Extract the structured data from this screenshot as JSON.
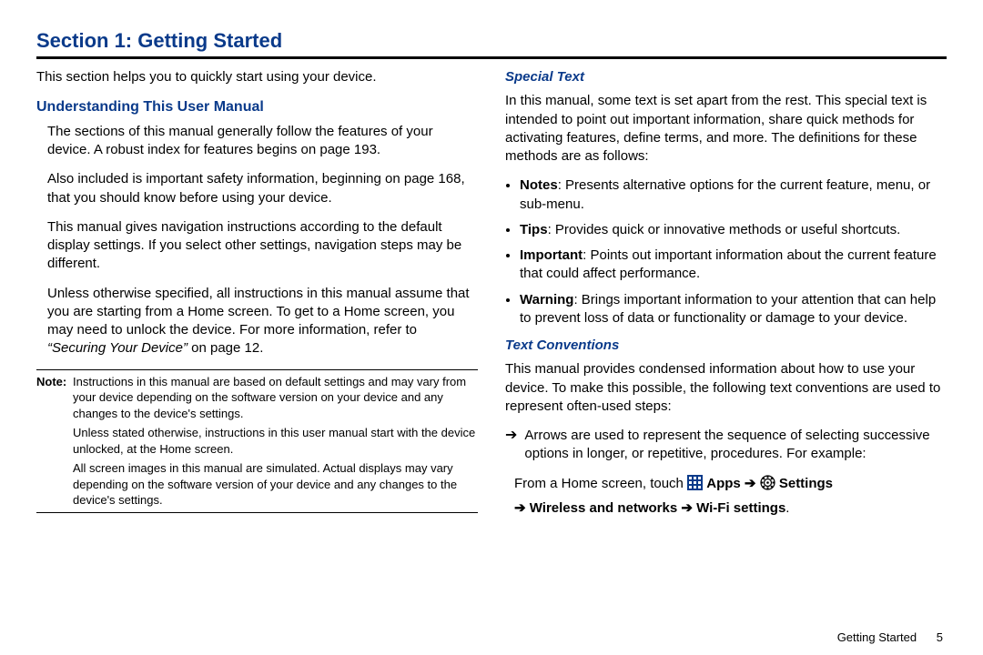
{
  "section_title": "Section 1: Getting Started",
  "left": {
    "intro": "This section helps you to quickly start using your device.",
    "h_understanding": "Understanding This User Manual",
    "p1": "The sections of this manual generally follow the features of your device. A robust index for features begins on page 193.",
    "p2": "Also included is important safety information, beginning on page 168, that you should know before using your device.",
    "p3": "This manual gives navigation instructions according to the default display settings. If you select other settings, navigation steps may be different.",
    "p4a": "Unless otherwise specified, all instructions in this manual assume that you are starting from a Home screen. To get to a Home screen, you may need to unlock the device. For more information, refer to ",
    "p4_ref": "“Securing Your Device”",
    "p4b": " on page 12.",
    "note_label": "Note:",
    "note1": "Instructions in this manual are based on default settings and may vary from your device depending on the software version on your device and any changes to the device's settings.",
    "note2": "Unless stated otherwise, instructions in this user manual start with the device unlocked, at the Home screen.",
    "note3": "All screen images in this manual are simulated. Actual displays may vary depending on the software version of your device and any changes to the device's settings."
  },
  "right": {
    "h_special": "Special Text",
    "special_p": "In this manual, some text is set apart from the rest. This special text is intended to point out important information, share quick methods for activating features, define terms, and more. The definitions for these methods are as follows:",
    "bullets": [
      {
        "lead": "Notes",
        "text": ": Presents alternative options for the current feature, menu, or sub-menu."
      },
      {
        "lead": "Tips",
        "text": ": Provides quick or innovative methods or useful shortcuts."
      },
      {
        "lead": "Important",
        "text": ": Points out important information about the current feature that could affect performance."
      },
      {
        "lead": "Warning",
        "text": ": Brings important information to your attention that can help to prevent loss of data or functionality or damage to your device."
      }
    ],
    "h_textconv": "Text Conventions",
    "textconv_p": "This manual provides condensed information about how to use your device. To make this possible, the following text conventions are used to represent often-used steps:",
    "arrow_glyph": "➔",
    "arrow_text": "Arrows are used to represent the sequence of selecting successive options in longer, or repetitive, procedures. For example:",
    "example_prefix": "From a Home screen, touch ",
    "apps_label": "Apps",
    "arrow1": "➔",
    "settings_label": "Settings",
    "arrow2": "➔",
    "wireless_label": "Wireless and networks",
    "arrow3": "➔",
    "wifi_label": "Wi-Fi settings",
    "period": "."
  },
  "footer": {
    "text": "Getting Started",
    "page": "5"
  }
}
